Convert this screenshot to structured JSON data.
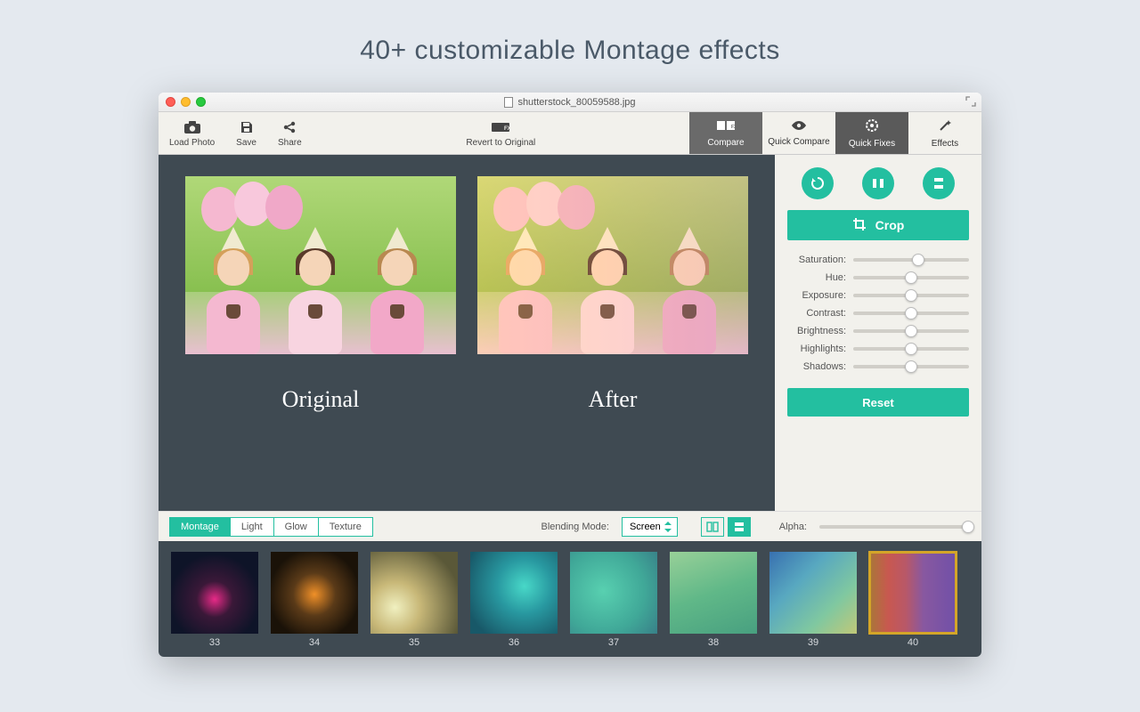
{
  "hero": {
    "headline": "40+ customizable Montage effects"
  },
  "titlebar": {
    "filename": "shutterstock_80059588.jpg"
  },
  "toolbar": {
    "load_photo": "Load Photo",
    "save": "Save",
    "share": "Share",
    "revert": "Revert to Original",
    "compare": "Compare",
    "quick_compare": "Quick Compare",
    "quick_fixes": "Quick Fixes",
    "effects": "Effects"
  },
  "canvas": {
    "original_label": "Original",
    "after_label": "After"
  },
  "sidepanel": {
    "crop": "Crop",
    "sliders": [
      {
        "label": "Saturation:",
        "value": 56
      },
      {
        "label": "Hue:",
        "value": 50
      },
      {
        "label": "Exposure:",
        "value": 50
      },
      {
        "label": "Contrast:",
        "value": 50
      },
      {
        "label": "Brightness:",
        "value": 50
      },
      {
        "label": "Highlights:",
        "value": 50
      },
      {
        "label": "Shadows:",
        "value": 50
      }
    ],
    "reset": "Reset"
  },
  "filterbar": {
    "tabs": [
      "Montage",
      "Light",
      "Glow",
      "Texture"
    ],
    "active_tab": 0,
    "blend_label": "Blending Mode:",
    "blend_value": "Screen",
    "alpha_label": "Alpha:"
  },
  "thumbs": [
    {
      "id": "33"
    },
    {
      "id": "34"
    },
    {
      "id": "35"
    },
    {
      "id": "36"
    },
    {
      "id": "37"
    },
    {
      "id": "38"
    },
    {
      "id": "39"
    },
    {
      "id": "40"
    }
  ],
  "selected_thumb": "40"
}
